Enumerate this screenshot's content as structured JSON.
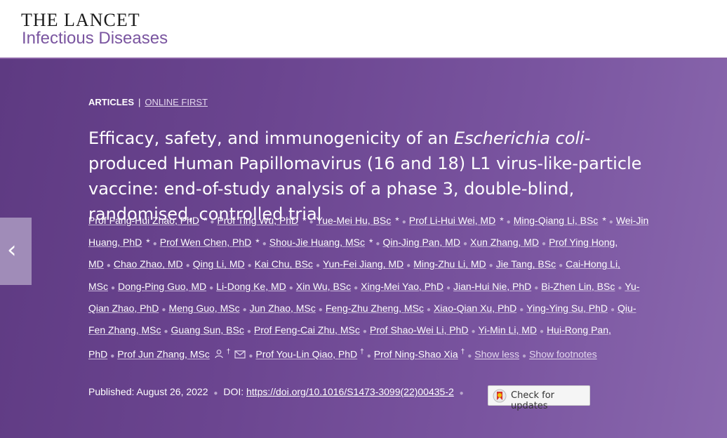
{
  "header": {
    "logo_line1": "THE LANCET",
    "logo_line2": "Infectious Diseases"
  },
  "nav": {
    "prev_icon": "‹"
  },
  "article": {
    "section": "ARTICLES",
    "separator": "|",
    "status": "ONLINE FIRST",
    "title_part1": "Efficacy, safety, and immunogenicity of an ",
    "title_italic": "Escherichia coli",
    "title_part2": "-produced Human Papillomavirus (16 and 18) L1 virus-like-particle vaccine: end-of-study analysis of a phase 3, double-blind, randomised, controlled trial"
  },
  "authors": [
    {
      "name": "Prof Fang-Hui Zhao, PhD",
      "mark": "*"
    },
    {
      "name": "Prof Ting Wu, PhD",
      "mark": "*"
    },
    {
      "name": "Yue-Mei Hu, BSc",
      "mark": "*"
    },
    {
      "name": "Prof Li-Hui Wei, MD",
      "mark": "*"
    },
    {
      "name": "Ming-Qiang Li, BSc",
      "mark": "*"
    },
    {
      "name": "Wei-Jin Huang, PhD",
      "mark": "*"
    },
    {
      "name": "Prof Wen Chen, PhD",
      "mark": "*"
    },
    {
      "name": "Shou-Jie Huang, MSc",
      "mark": "*"
    },
    {
      "name": "Qin-Jing Pan, MD",
      "mark": ""
    },
    {
      "name": "Xun Zhang, MD",
      "mark": ""
    },
    {
      "name": "Prof Ying Hong, MD",
      "mark": ""
    },
    {
      "name": "Chao Zhao, MD",
      "mark": ""
    },
    {
      "name": "Qing Li, MD",
      "mark": ""
    },
    {
      "name": "Kai Chu, BSc",
      "mark": ""
    },
    {
      "name": "Yun-Fei Jiang, MD",
      "mark": ""
    },
    {
      "name": "Ming-Zhu Li, MD",
      "mark": ""
    },
    {
      "name": "Jie Tang, BSc",
      "mark": ""
    },
    {
      "name": "Cai-Hong Li, MSc",
      "mark": ""
    },
    {
      "name": "Dong-Ping Guo, MD",
      "mark": ""
    },
    {
      "name": "Li-Dong Ke, MD",
      "mark": ""
    },
    {
      "name": "Xin Wu, BSc",
      "mark": ""
    },
    {
      "name": "Xing-Mei Yao, PhD",
      "mark": ""
    },
    {
      "name": "Jian-Hui Nie, PhD",
      "mark": ""
    },
    {
      "name": "Bi-Zhen Lin, BSc",
      "mark": ""
    },
    {
      "name": "Yu-Qian Zhao, PhD",
      "mark": ""
    },
    {
      "name": "Meng Guo, MSc",
      "mark": ""
    },
    {
      "name": "Jun Zhao, MSc",
      "mark": ""
    },
    {
      "name": "Feng-Zhu Zheng, MSc",
      "mark": ""
    },
    {
      "name": "Xiao-Qian Xu, PhD",
      "mark": ""
    },
    {
      "name": "Ying-Ying Su, PhD",
      "mark": ""
    },
    {
      "name": "Qiu-Fen Zhang, MSc",
      "mark": ""
    },
    {
      "name": "Guang Sun, BSc",
      "mark": ""
    },
    {
      "name": "Prof Feng-Cai Zhu, MSc",
      "mark": ""
    },
    {
      "name": "Prof Shao-Wei Li, PhD",
      "mark": ""
    },
    {
      "name": "Yi-Min Li, MD",
      "mark": ""
    },
    {
      "name": "Hui-Rong Pan, PhD",
      "mark": ""
    },
    {
      "name": "Prof Jun Zhang, MSc",
      "mark": "corr"
    },
    {
      "name": "Prof You-Lin Qiao, PhD",
      "mark": "†"
    },
    {
      "name": "Prof Ning-Shao Xia",
      "mark": "†"
    }
  ],
  "author_links": {
    "dagger": "†",
    "show_less": "Show less",
    "show_footnotes": "Show footnotes"
  },
  "publication": {
    "published_label": "Published:",
    "published_date": "August 26, 2022",
    "doi_label": "DOI:",
    "doi_url": "https://doi.org/10.1016/S1473-3099(22)00435-2",
    "check_updates": "Check for updates"
  }
}
